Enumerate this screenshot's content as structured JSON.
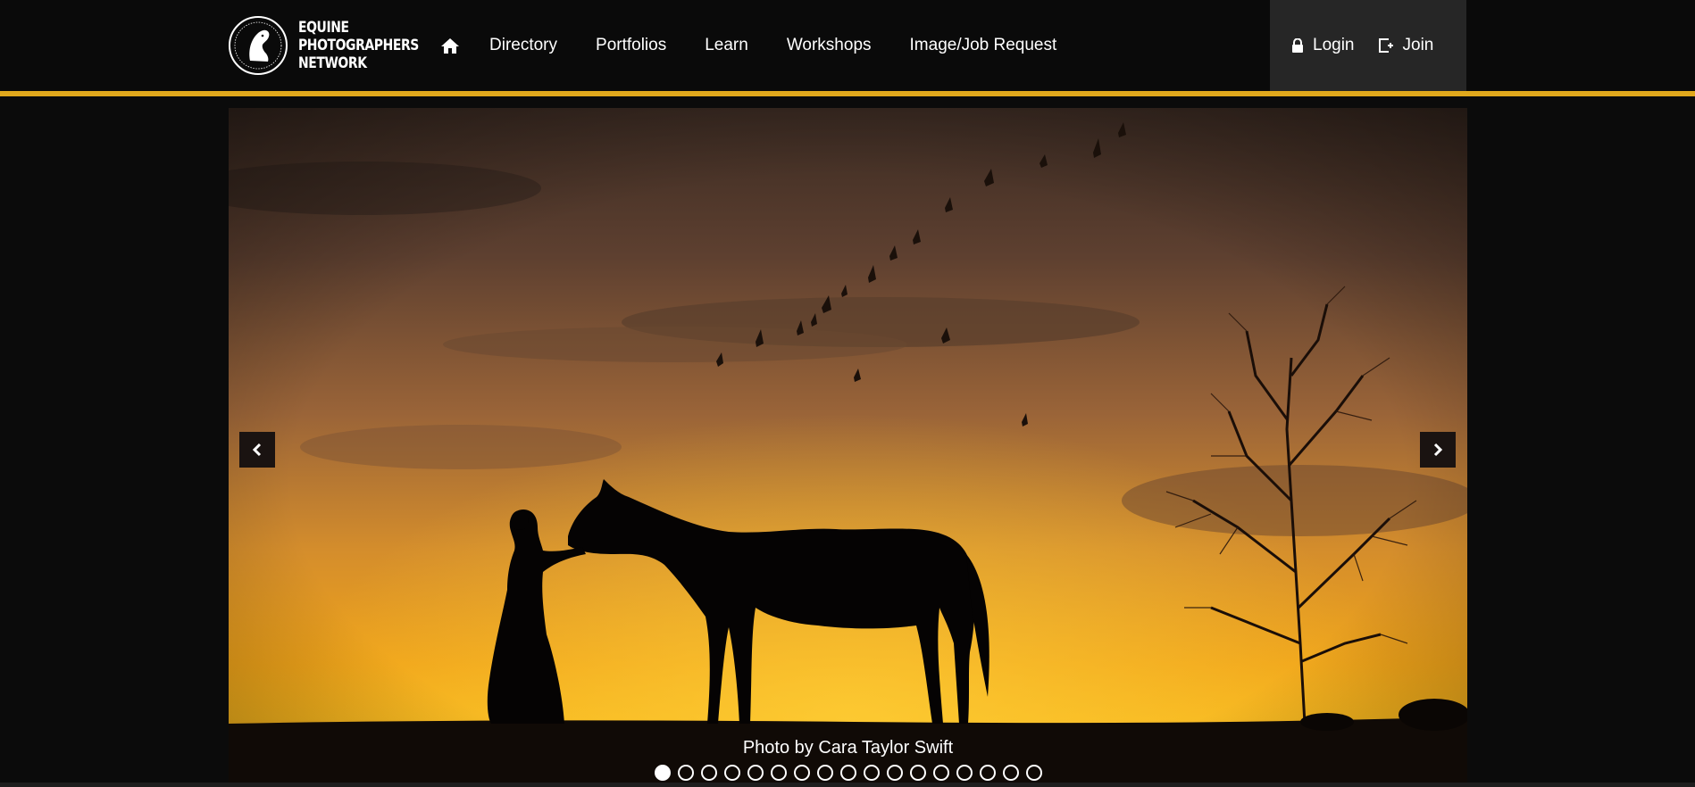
{
  "brand": {
    "lines": [
      "EQUINE",
      "PHOTOGRAPHERS",
      "NETWORK"
    ],
    "ring_text": "EQUINE PHOTOGRAPHERS NETWORK",
    "accent_color": "#e0a81c"
  },
  "nav": {
    "home_icon": "home-icon",
    "items": [
      {
        "label": "Directory"
      },
      {
        "label": "Portfolios"
      },
      {
        "label": "Learn"
      },
      {
        "label": "Workshops"
      },
      {
        "label": "Image/Job Request"
      }
    ]
  },
  "account": {
    "login": {
      "label": "Login",
      "icon": "lock-icon"
    },
    "join": {
      "label": "Join",
      "icon": "join-icon"
    }
  },
  "slider": {
    "caption": "Photo by Cara Taylor Swift",
    "slide_count": 17,
    "active_index": 0,
    "prev_icon": "chevron-left-icon",
    "next_icon": "chevron-right-icon"
  }
}
